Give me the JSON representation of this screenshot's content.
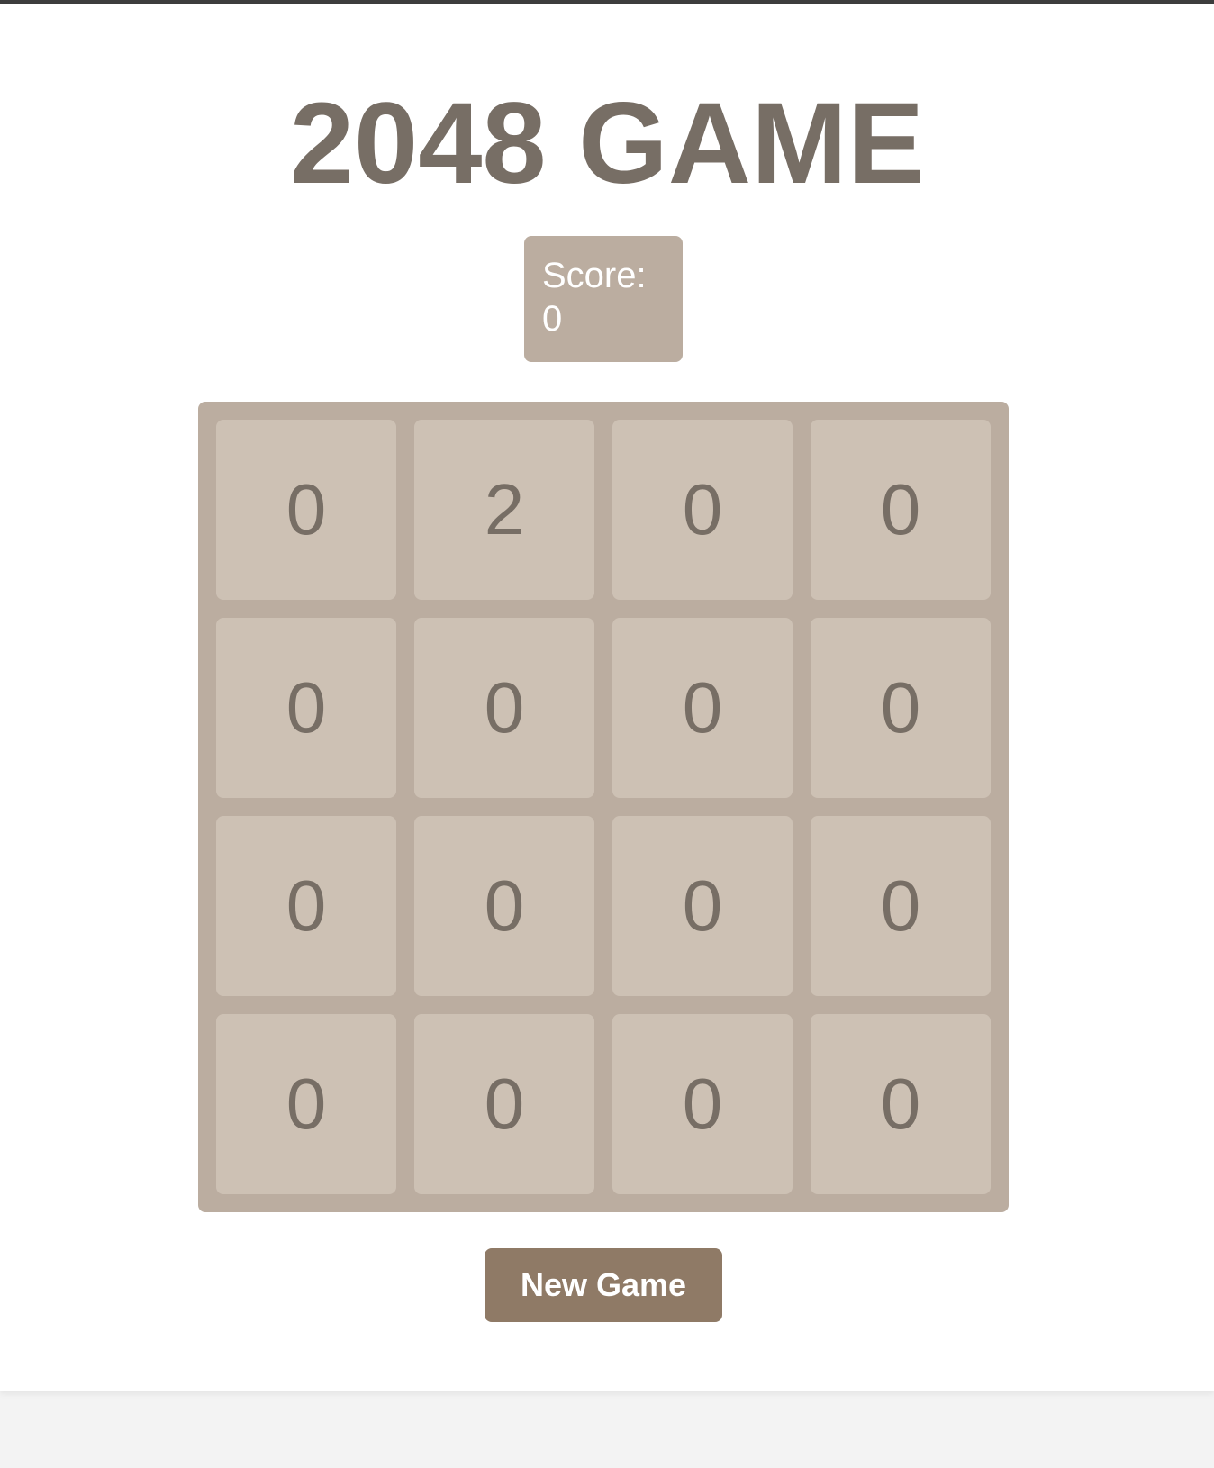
{
  "title": "2048 GAME",
  "score": {
    "label": "Score:",
    "value": "0"
  },
  "board": {
    "rows": [
      [
        "0",
        "2",
        "0",
        "0"
      ],
      [
        "0",
        "0",
        "0",
        "0"
      ],
      [
        "0",
        "0",
        "0",
        "0"
      ],
      [
        "0",
        "0",
        "0",
        "0"
      ]
    ]
  },
  "controls": {
    "new_game_label": "New Game"
  },
  "colors": {
    "title_text": "#776e65",
    "board_bg": "#bbada0",
    "tile_bg": "#cdc1b4",
    "button_bg": "#8f7a66"
  }
}
